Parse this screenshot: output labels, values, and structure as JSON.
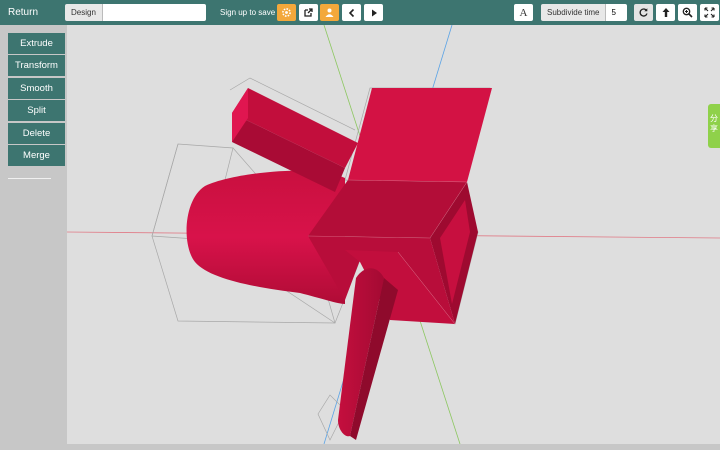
{
  "toolbar": {
    "return_label": "Return",
    "design_name_label": "Design Name",
    "design_name_value": "",
    "signup_text": "Sign up to save",
    "font_label": "A",
    "subdivide_label": "Subdivide time",
    "subdivide_value": "5",
    "icons": [
      "gear-icon",
      "external-link-icon",
      "user-icon",
      "chevron-left-icon",
      "play-icon",
      "refresh-icon",
      "upload-icon",
      "zoom-in-icon",
      "fullscreen-icon"
    ]
  },
  "sidebar": {
    "items": [
      {
        "label": "Extrude"
      },
      {
        "label": "Transform"
      },
      {
        "label": "Smooth"
      },
      {
        "label": "Split"
      },
      {
        "label": "Delete"
      },
      {
        "label": "Merge"
      }
    ]
  },
  "share_tab": {
    "label": "分享"
  },
  "colors": {
    "toolbar_bg": "#3d7570",
    "accent_orange": "#f3a83b",
    "model_red": "#cc1040",
    "share_green": "#8fd14a",
    "viewport_bg": "#dedede"
  }
}
